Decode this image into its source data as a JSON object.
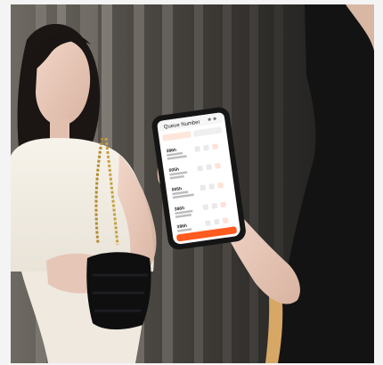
{
  "photo": {
    "background": "#2b2a28",
    "frame_color": "#f4f4f4",
    "accent": "#ff5a1f"
  },
  "device_screen": {
    "app_title": "Queue Number",
    "tabs": [
      "",
      ""
    ],
    "queue_items": [
      {
        "number": "386h"
      },
      {
        "number": "005h"
      },
      {
        "number": "005h"
      },
      {
        "number": "386h"
      },
      {
        "number": "386h"
      }
    ],
    "primary_button": ""
  }
}
